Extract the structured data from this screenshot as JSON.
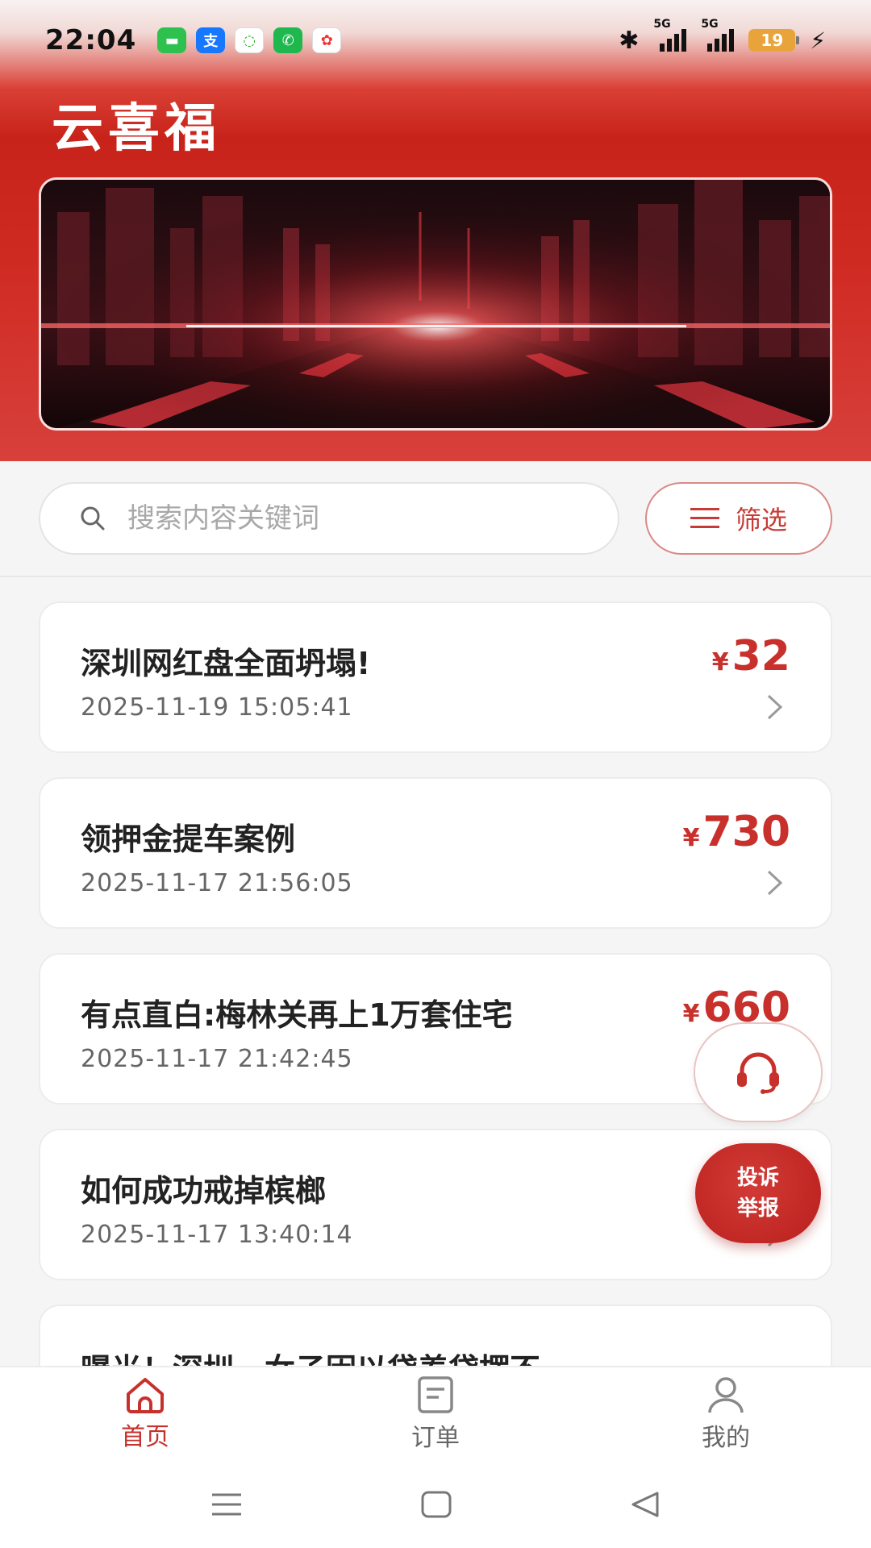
{
  "status_bar": {
    "time": "22:04",
    "network_1": "5G",
    "network_2": "5G",
    "battery": "19"
  },
  "app_title": "云喜福",
  "search": {
    "placeholder": "搜索内容关键词"
  },
  "filter_label": "筛选",
  "articles": [
    {
      "title": "深圳网红盘全面坍塌!",
      "time": "2025-11-19 15:05:41",
      "currency": "¥",
      "price": "32"
    },
    {
      "title": "领押金提车案例",
      "time": "2025-11-17 21:56:05",
      "currency": "¥",
      "price": "730"
    },
    {
      "title": "有点直白:梅林关再上1万套住宅",
      "time": "2025-11-17 21:42:45",
      "currency": "¥",
      "price": "660"
    },
    {
      "title": "如何成功戒掉槟榔",
      "time": "2025-11-17 13:40:14",
      "currency": "¥",
      "price": ""
    },
    {
      "title": "曝光！深圳一女子因以贷养贷摆不",
      "time": "",
      "currency": "",
      "price": ""
    }
  ],
  "float_report": {
    "line1": "投诉",
    "line2": "举报"
  },
  "tabs": [
    {
      "label": "首页",
      "icon": "home-icon",
      "active": true
    },
    {
      "label": "订单",
      "icon": "order-icon",
      "active": false
    },
    {
      "label": "我的",
      "icon": "profile-icon",
      "active": false
    }
  ],
  "colors": {
    "brand_red": "#c8302c",
    "header_red": "#cf2a22"
  }
}
